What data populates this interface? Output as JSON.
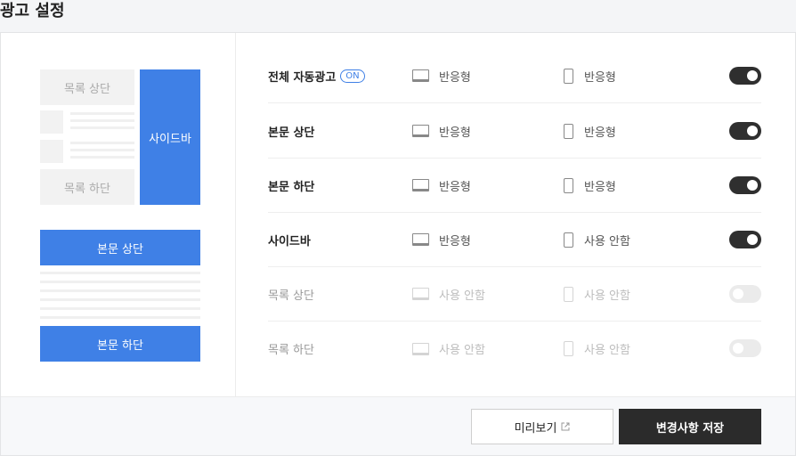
{
  "page": {
    "title": "광고 설정"
  },
  "preview": {
    "list_top": "목록 상단",
    "list_bottom": "목록 하단",
    "sidebar": "사이드바",
    "body_top": "본문 상단",
    "body_bottom": "본문 하단"
  },
  "settings": {
    "rows": [
      {
        "label": "전체 자동광고",
        "badge": "ON",
        "pc": "반응형",
        "mobile": "반응형",
        "enabled": true
      },
      {
        "label": "본문 상단",
        "pc": "반응형",
        "mobile": "반응형",
        "enabled": true
      },
      {
        "label": "본문 하단",
        "pc": "반응형",
        "mobile": "반응형",
        "enabled": true
      },
      {
        "label": "사이드바",
        "pc": "반응형",
        "mobile": "사용 안함",
        "enabled": true
      },
      {
        "label": "목록 상단",
        "pc": "사용 안함",
        "mobile": "사용 안함",
        "enabled": false
      },
      {
        "label": "목록 하단",
        "pc": "사용 안함",
        "mobile": "사용 안함",
        "enabled": false
      }
    ]
  },
  "footer": {
    "preview_button": "미리보기",
    "save_button": "변경사항 저장"
  },
  "icons": {
    "pc": "monitor-icon",
    "mobile": "mobile-phone-icon",
    "external": "external-link-icon"
  },
  "colors": {
    "accent": "#3f80e6",
    "toggle_on": "#2f2f2f",
    "toggle_off": "#ebebeb",
    "save_button": "#2b2b2b"
  }
}
